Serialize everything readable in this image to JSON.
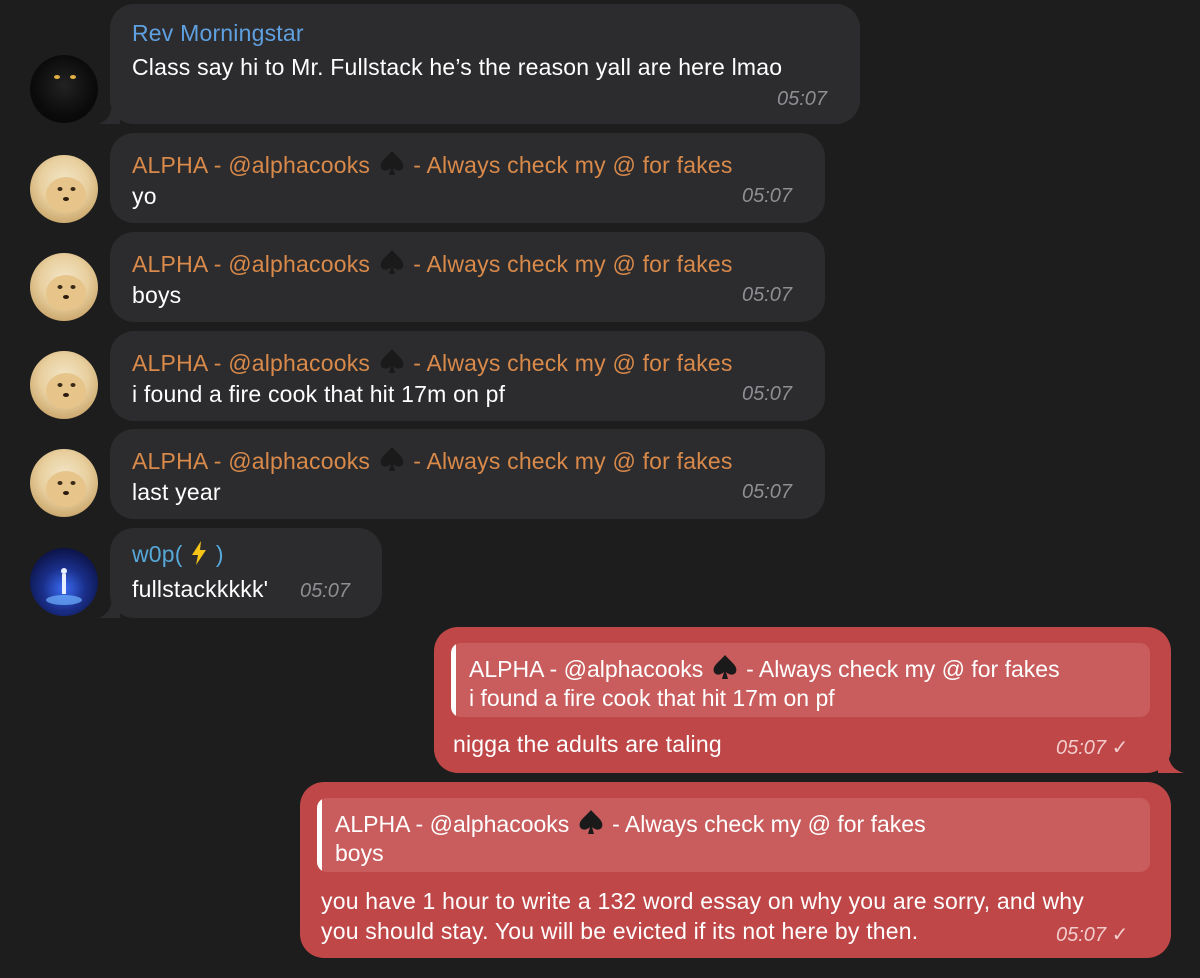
{
  "messages": [
    {
      "sender": "Rev Morningstar",
      "text": "Class say hi to Mr. Fullstack he’s the reason yall are here lmao",
      "time": "05:07"
    },
    {
      "sender_prefix": "ALPHA - @alphacooks",
      "sender_suffix": "- Always check my @ for fakes",
      "text": "yo",
      "time": "05:07"
    },
    {
      "sender_prefix": "ALPHA - @alphacooks",
      "sender_suffix": "- Always check my @ for fakes",
      "text": "boys",
      "time": "05:07"
    },
    {
      "sender_prefix": "ALPHA - @alphacooks",
      "sender_suffix": "- Always check my @ for fakes",
      "text": "i found a fire cook that hit 17m on pf",
      "time": "05:07"
    },
    {
      "sender_prefix": "ALPHA - @alphacooks",
      "sender_suffix": "- Always check my @ for fakes",
      "text": "last year",
      "time": "05:07"
    },
    {
      "sender_prefix": "w0p(",
      "sender_suffix": ")",
      "text": "fullstackkkkk'",
      "time": "05:07"
    }
  ],
  "outgoing": [
    {
      "reply_prefix": "ALPHA - @alphacooks",
      "reply_suffix": "- Always check my @ for fakes",
      "reply_text": "i found a fire cook that hit 17m on pf",
      "text": "nigga the adults are taling",
      "time": "05:07",
      "check": "✓"
    },
    {
      "reply_prefix": "ALPHA - @alphacooks",
      "reply_suffix": "- Always check my @ for fakes",
      "reply_text": "boys",
      "text_line1": "you have 1 hour to write a 132 word essay on why you are sorry, and why",
      "text_line2": "you should stay. You will be evicted if its not here by then.",
      "time": "05:07",
      "check": "✓"
    }
  ],
  "colors": {
    "background": "#1d1d1d",
    "incoming_bubble": "#2c2c2e",
    "outgoing_bubble": "#bf4748",
    "sender_blue": "#5fa0e0",
    "sender_orange": "#d98a4a"
  },
  "icons": [
    "spade-emoji",
    "lightning-emoji",
    "read-check-icon"
  ]
}
